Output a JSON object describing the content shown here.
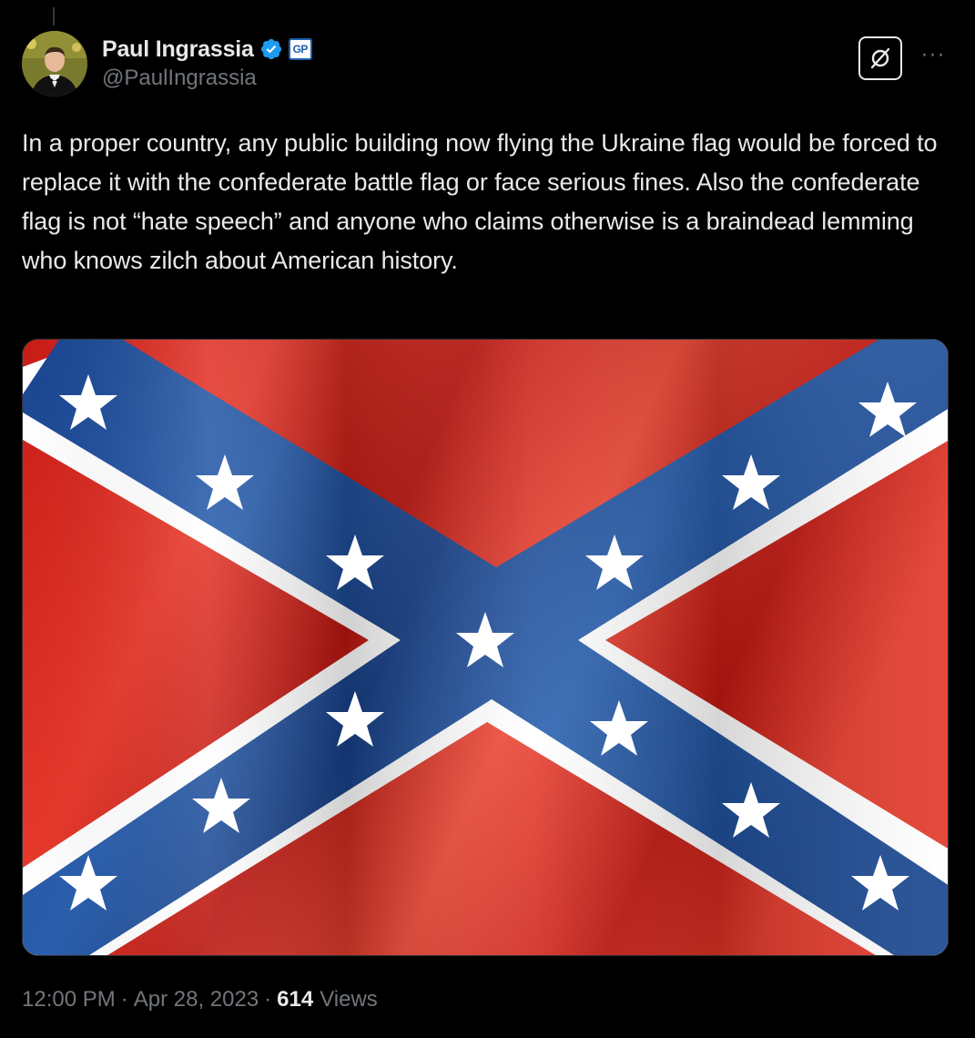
{
  "tweet": {
    "author": {
      "display_name": "Paul Ingrassia",
      "handle": "@PaulIngrassia",
      "verified": true,
      "affiliation_badge": "GP",
      "avatar_icon": "avatar-photo"
    },
    "text": "In a proper country, any public building now flying the Ukraine flag would be forced to replace it with the confederate battle flag or face serious fines. Also the confederate flag is not “hate speech” and anyone who claims otherwise is a braindead lemming who knows zilch about American history.",
    "media": {
      "type": "image",
      "icon": "confederate-battle-flag"
    },
    "time": "12:00 PM",
    "date": "Apr 28, 2023",
    "separator": "·",
    "views_count": "614",
    "views_label": "Views"
  },
  "actions": {
    "grok_icon": "grok-icon",
    "more_icon": "more-icon",
    "more_label": "···"
  },
  "colors": {
    "background": "#000000",
    "text_primary": "#e7e9ea",
    "text_secondary": "#71767b",
    "verified_blue": "#1d9bf0",
    "flag_red": "#d8241f",
    "flag_blue": "#1f4f9a",
    "flag_white": "#ffffff"
  }
}
